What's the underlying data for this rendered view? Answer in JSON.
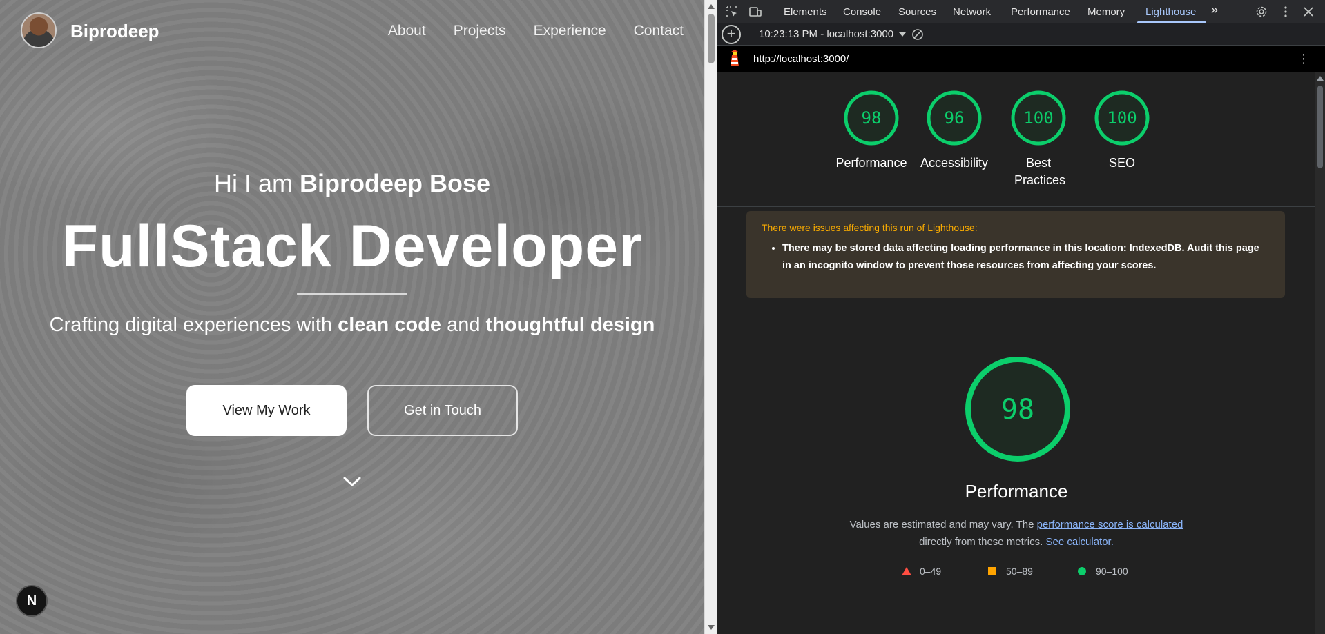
{
  "site": {
    "brand": "Biprodeep",
    "nav": [
      "About",
      "Projects",
      "Experience",
      "Contact"
    ],
    "hero": {
      "greeting": "Hi I am",
      "name": "Biprodeep Bose",
      "title": "FullStack Developer",
      "sub_pre": "Crafting digital experiences with",
      "sub_b1": "clean code",
      "sub_mid": "and",
      "sub_b2": "thoughtful design"
    },
    "buttons": {
      "primary": "View My Work",
      "secondary": "Get in Touch"
    },
    "badge": "N"
  },
  "devtools": {
    "tabs": [
      "Elements",
      "Console",
      "Sources",
      "Network",
      "Performance",
      "Memory",
      "Lighthouse"
    ],
    "active_tab": "Lighthouse",
    "run_label": "10:23:13 PM - localhost:3000",
    "url": "http://localhost:3000/",
    "scores": [
      {
        "label": "Performance",
        "value": "98"
      },
      {
        "label": "Accessibility",
        "value": "96"
      },
      {
        "label": "Best Practices",
        "value": "100"
      },
      {
        "label": "SEO",
        "value": "100"
      }
    ],
    "warning": {
      "title": "There were issues affecting this run of Lighthouse:",
      "item": "There may be stored data affecting loading performance in this location: IndexedDB. Audit this page in an incognito window to prevent those resources from affecting your scores."
    },
    "performance": {
      "score": "98",
      "title": "Performance",
      "desc_pre": "Values are estimated and may vary. The",
      "desc_link1": "performance score is calculated",
      "desc_mid": "directly from these metrics.",
      "desc_link2": "See calculator."
    },
    "legend": [
      "0–49",
      "50–89",
      "90–100"
    ],
    "colors": {
      "pass": "#0cce6b",
      "average": "#ffa400",
      "fail": "#ff4e42",
      "active_tab": "#a8c7fa",
      "warning_title": "#f9ab00"
    }
  }
}
